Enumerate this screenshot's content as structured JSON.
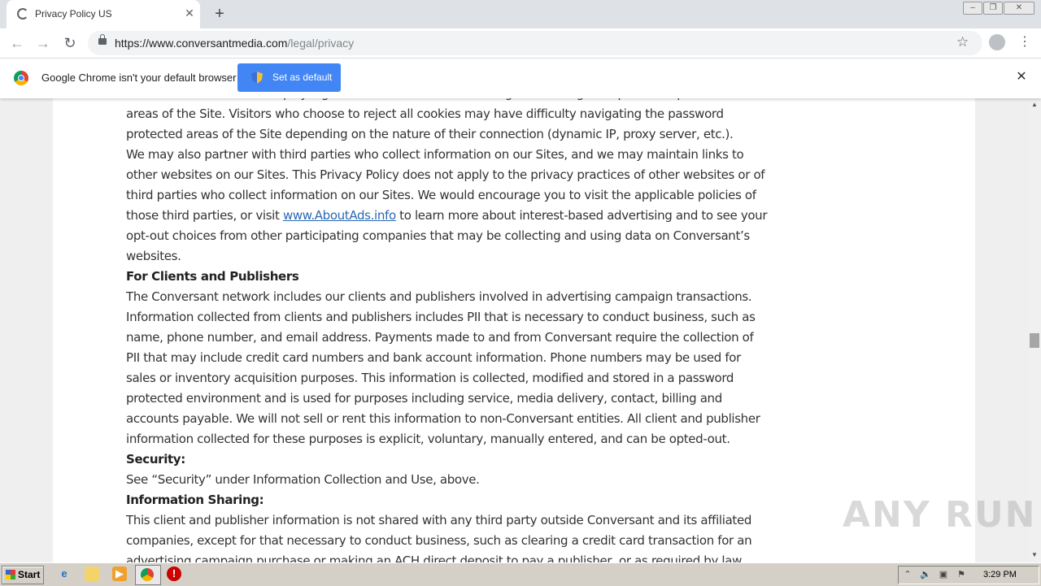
{
  "browser": {
    "tab_title": "Privacy Policy US",
    "tab_close": "✕",
    "new_tab": "+",
    "url_host": "https://www.conversantmedia.com",
    "url_path": "/legal/privacy"
  },
  "infobar": {
    "message": "Google Chrome isn't your default browser",
    "set_default_label": "Set as default",
    "close": "✕"
  },
  "content": {
    "p1": "We also use cookies to simplify login and to facilitate secure navigation through the password protected areas of the Site. Visitors who choose to reject all cookies may have difficulty navigating the password protected areas of the Site depending on the nature of their connection (dynamic IP, proxy server, etc.).",
    "p2_before": "We may also partner with third parties who collect information on our Sites, and we may maintain links to other websites on our Sites. This Privacy Policy does not apply to the privacy practices of other websites or of third parties who collect information on our Sites. We would encourage you to visit the applicable policies of those third parties, or visit ",
    "p2_link": "www.AboutAds.info",
    "p2_after": " to learn more about interest-based advertising and to see your opt-out choices from other participating companies that may be collecting and using data on Conversant’s websites.",
    "h_clients": "For Clients and Publishers",
    "p3": "The Conversant network includes our clients and publishers involved in advertising campaign transactions. Information collected from clients and publishers includes PII that is necessary to conduct business, such as name, phone number, and email address. Payments made to and from Conversant require the collection of PII that may include credit card numbers and bank account information. Phone numbers may be used for sales or inventory acquisition purposes. This information is collected, modified and stored in a password protected environment and is used for purposes including service, media delivery, contact, billing and accounts payable. We will not sell or rent this information to non-Conversant entities. All client and publisher information collected for these purposes is explicit, voluntary, manually entered, and can be opted-out.",
    "h_security": "Security:",
    "p4": "See “Security” under Information Collection and Use, above.",
    "h_sharing": "Information Sharing:",
    "p5": "This client and publisher information is not shared with any third party outside Conversant and its affiliated companies, except for that necessary to conduct business, such as clearing a credit card transaction for an advertising campaign purchase or making an ACH direct deposit to pay a publisher, or as required by law. The"
  },
  "watermark": "ANY RUN",
  "taskbar": {
    "start_label": "Start",
    "clock": "3:29 PM"
  },
  "colors": {
    "link": "#2a68b5",
    "button_blue": "#4285f4",
    "taskbar": "#d4d0c8"
  }
}
